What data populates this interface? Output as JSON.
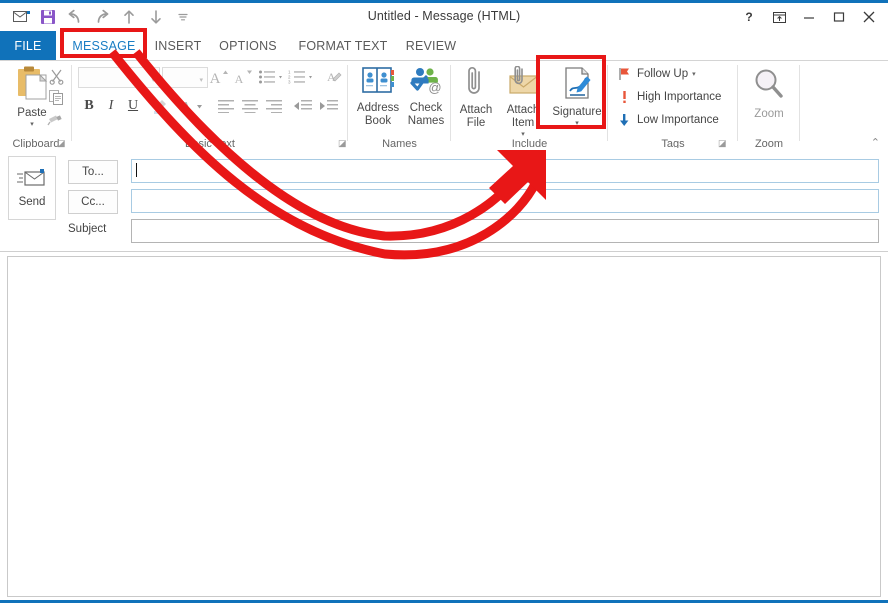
{
  "window": {
    "title": "Untitled - Message (HTML)",
    "accent_blue": "#1072ba",
    "annotation_color": "#e81717"
  },
  "quick_access": {
    "items": [
      {
        "name": "envelope-icon",
        "label": "New Message"
      },
      {
        "name": "save-icon",
        "label": "Save"
      },
      {
        "name": "undo-icon",
        "label": "Undo"
      },
      {
        "name": "redo-icon",
        "label": "Redo"
      },
      {
        "name": "previous-item-icon",
        "label": "Previous Item"
      },
      {
        "name": "next-item-icon",
        "label": "Next Item"
      },
      {
        "name": "customize-quick-access-icon",
        "label": "Customize Quick Access Toolbar"
      }
    ]
  },
  "window_controls": [
    {
      "name": "help-button",
      "glyph": "?"
    },
    {
      "name": "ribbon-display-options-button",
      "glyph": "⤒"
    },
    {
      "name": "minimize-button",
      "glyph": "–"
    },
    {
      "name": "maximize-button",
      "glyph": "□"
    },
    {
      "name": "close-button",
      "glyph": "✕"
    }
  ],
  "tabs": [
    {
      "label": "FILE",
      "active": false
    },
    {
      "label": "MESSAGE",
      "active": true
    },
    {
      "label": "INSERT",
      "active": false
    },
    {
      "label": "OPTIONS",
      "active": false
    },
    {
      "label": "FORMAT TEXT",
      "active": false
    },
    {
      "label": "REVIEW",
      "active": false
    }
  ],
  "ribbon": {
    "groups": [
      {
        "label": "Clipboard",
        "has_dialog_launcher": true
      },
      {
        "label": "Basic Text",
        "has_dialog_launcher": true
      },
      {
        "label": "Names",
        "has_dialog_launcher": false
      },
      {
        "label": "Include",
        "has_dialog_launcher": false
      },
      {
        "label": "Tags",
        "has_dialog_launcher": true
      },
      {
        "label": "Zoom",
        "has_dialog_launcher": false
      }
    ],
    "clipboard": {
      "paste_label": "Paste",
      "cut_label": "Cut",
      "copy_label": "Copy",
      "format_painter_label": "Format Painter"
    },
    "basic_text": {
      "font_name_value": "",
      "font_size_value": "",
      "grow_font_label": "Grow Font",
      "shrink_font_label": "Shrink Font",
      "bullets_label": "Bullets",
      "numbering_label": "Numbering",
      "clear_formatting_label": "Clear All Formatting",
      "bold_label": "B",
      "italic_label": "I",
      "underline_label": "U",
      "highlight_label": "Text Highlight Color",
      "font_color_label": "Font Color",
      "align_left_label": "Align Left",
      "center_label": "Center",
      "align_right_label": "Align Right",
      "decrease_indent_label": "Decrease Indent",
      "increase_indent_label": "Increase Indent"
    },
    "names": {
      "address_book_line1": "Address",
      "address_book_line2": "Book",
      "check_names_line1": "Check",
      "check_names_line2": "Names"
    },
    "include": {
      "attach_file_line1": "Attach",
      "attach_file_line2": "File",
      "attach_item_line1": "Attach",
      "attach_item_line2": "Item",
      "signature_label": "Signature"
    },
    "tags": {
      "follow_up_label": "Follow Up",
      "high_importance_label": "High Importance",
      "low_importance_label": "Low Importance"
    },
    "zoom": {
      "zoom_label": "Zoom"
    },
    "collapse_ribbon_label": "Collapse the Ribbon"
  },
  "compose": {
    "send_label": "Send",
    "to_button_label": "To...",
    "cc_button_label": "Cc...",
    "subject_label": "Subject",
    "to_value": "",
    "cc_value": "",
    "subject_value": "",
    "body_value": ""
  },
  "annotations": {
    "message_tab_highlight": "MESSAGE",
    "signature_highlight": "Signature",
    "arrow_description": "curved arrow from MESSAGE tab to Signature button"
  }
}
